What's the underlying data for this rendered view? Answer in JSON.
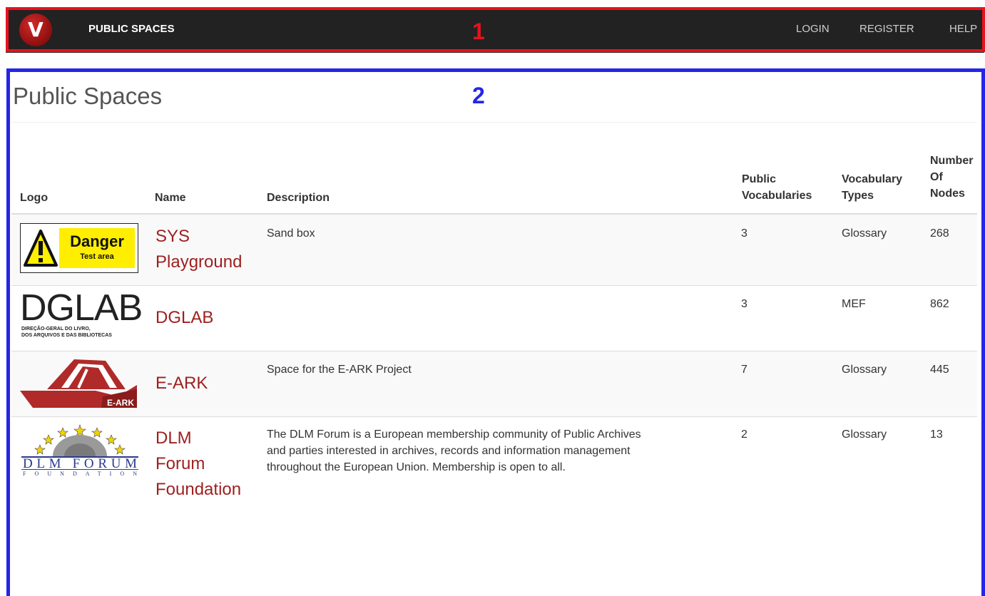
{
  "navbar": {
    "logo_letter": "V",
    "brand": "PUBLIC SPACES",
    "links": [
      "LOGIN",
      "REGISTER",
      "HELP"
    ]
  },
  "annotations": {
    "marker_1": "1",
    "marker_2": "2"
  },
  "page": {
    "title": "Public Spaces"
  },
  "table": {
    "columns": [
      [
        "Logo"
      ],
      [
        "Name"
      ],
      [
        "Description"
      ],
      [
        "Public",
        "Vocabularies"
      ],
      [
        "Vocabulary",
        "Types"
      ],
      [
        "Number",
        "Of",
        "Nodes"
      ]
    ],
    "rows": [
      {
        "logo": {
          "name": "danger-test-area-logo",
          "title": "Danger",
          "subtitle": "Test area"
        },
        "name_lines": [
          "SYS",
          "Playground"
        ],
        "description": "Sand box",
        "public_vocabularies": "3",
        "vocabulary_types": "Glossary",
        "number_of_nodes": "268"
      },
      {
        "logo": {
          "name": "dglab-logo",
          "title": "DGLAB",
          "subtitle_lines": [
            "DIREÇÃO-GERAL DO LIVRO,",
            "DOS ARQUIVOS E DAS BIBLIOTECAS"
          ]
        },
        "name_lines": [
          "DGLAB"
        ],
        "description": "",
        "public_vocabularies": "3",
        "vocabulary_types": "MEF",
        "number_of_nodes": "862"
      },
      {
        "logo": {
          "name": "e-ark-logo",
          "title": "E-ARK"
        },
        "name_lines": [
          "E-ARK"
        ],
        "description": "Space for the E-ARK Project",
        "public_vocabularies": "7",
        "vocabulary_types": "Glossary",
        "number_of_nodes": "445"
      },
      {
        "logo": {
          "name": "dlm-forum-logo",
          "title": "DLM FORUM",
          "subtitle": "FOUNDATION"
        },
        "name_lines": [
          "DLM",
          "Forum",
          "Foundation"
        ],
        "description_lines": [
          "The DLM Forum is a European membership community of Public Archives",
          "and parties interested in archives, records and information management",
          "throughout the European Union. Membership is open to all."
        ],
        "public_vocabularies": "2",
        "vocabulary_types": "Glossary",
        "number_of_nodes": "13"
      }
    ]
  },
  "colors": {
    "navbar_bg": "#222222",
    "link_red": "#9e1f1f",
    "annotation_red": "#e8121c",
    "annotation_blue": "#2525e8",
    "danger_yellow": "#ffee00"
  }
}
